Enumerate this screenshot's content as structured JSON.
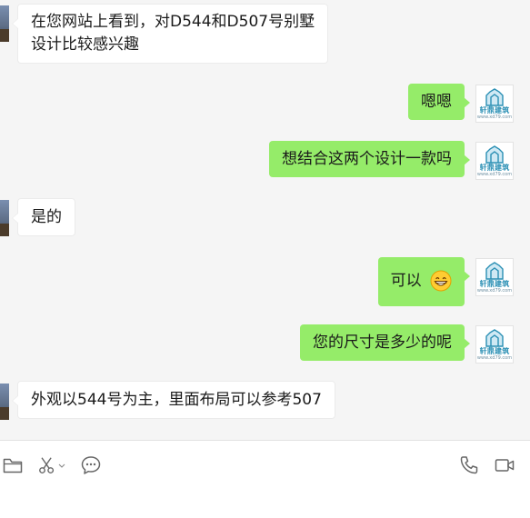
{
  "messages": [
    {
      "side": "left",
      "lines": [
        "在您网站上看到，对D544和D507号别墅",
        "设计比较感兴趣"
      ]
    },
    {
      "side": "right",
      "text": "嗯嗯"
    },
    {
      "side": "right",
      "text": "想结合这两个设计一款吗"
    },
    {
      "side": "left",
      "text": "是的"
    },
    {
      "side": "right",
      "text": "可以",
      "emoji": "grinning-face-emoji"
    },
    {
      "side": "right",
      "text": "您的尺寸是多少的呢"
    },
    {
      "side": "left",
      "text": "外观以544号为主，里面布局可以参考507"
    }
  ],
  "contact_avatar": {
    "brand_text": "轩鼎建筑",
    "url_text": "www.xd79.com",
    "brand_color": "#2a8fb4"
  },
  "toolbar": {
    "left_icons": [
      "folder-icon",
      "scissors-icon",
      "chat-bubble-icon"
    ],
    "right_icons": [
      "phone-icon",
      "video-camera-icon"
    ]
  },
  "colors": {
    "background": "#f5f5f5",
    "sent_bubble": "#95ec69",
    "received_bubble": "#ffffff",
    "input_area": "#ffffff"
  }
}
